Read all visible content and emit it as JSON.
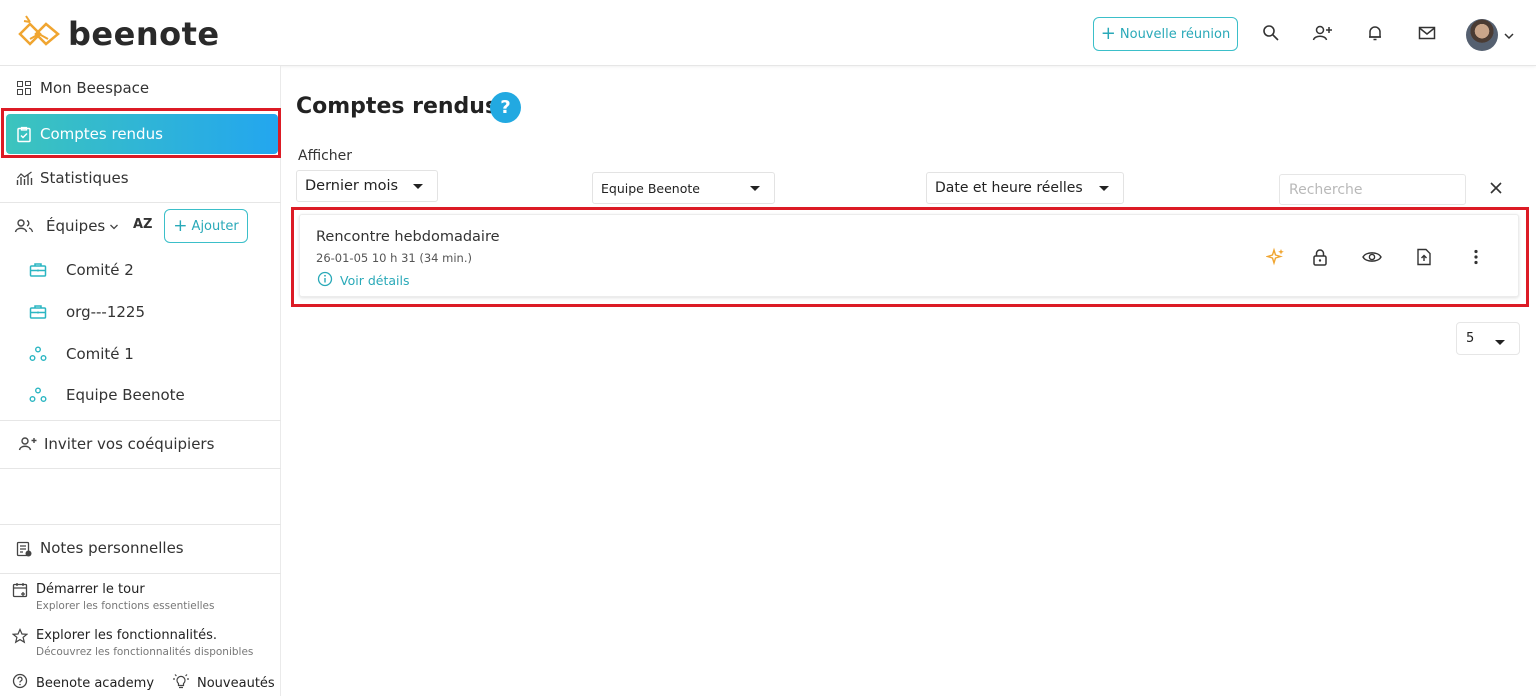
{
  "app": {
    "logo_text": "beenote",
    "accent": "#29a9b8",
    "highlight_color": "#dc1b25"
  },
  "topbar": {
    "new_meeting_label": "Nouvelle réunion",
    "icons": [
      "search-icon",
      "add-user-icon",
      "bell-icon",
      "mail-icon",
      "avatar",
      "chevron-down-icon"
    ]
  },
  "sidebar": {
    "items": [
      {
        "label": "Mon Beespace",
        "icon": "grid-icon"
      },
      {
        "label": "Comptes rendus",
        "icon": "clipboard-check-icon",
        "active": true
      },
      {
        "label": "Statistiques",
        "icon": "chart-icon"
      }
    ],
    "teams_label": "Équipes",
    "sort_label": "AZ",
    "add_label": "Ajouter",
    "teams": [
      {
        "label": "Comité 2",
        "icon": "briefcase-icon"
      },
      {
        "label": "org---1225",
        "icon": "briefcase-icon"
      },
      {
        "label": "Comité 1",
        "icon": "team-nodes-icon"
      },
      {
        "label": "Equipe Beenote",
        "icon": "team-nodes-icon"
      }
    ],
    "invite_label": "Inviter vos coéquipiers",
    "notes_label": "Notes personnelles",
    "tour": {
      "title": "Démarrer le tour",
      "subtitle": "Explorer les fonctions essentielles"
    },
    "explore": {
      "title": "Explorer les fonctionnalités.",
      "subtitle": "Découvrez les fonctionnalités disponibles"
    },
    "academy_label": "Beenote academy",
    "news_label": "Nouveautés"
  },
  "main": {
    "title": "Comptes rendus",
    "help_glyph": "?",
    "filter_label": "Afficher",
    "filters": {
      "period": "Dernier mois",
      "team": "Equipe Beenote",
      "date_mode": "Date et heure réelles"
    },
    "search_placeholder": "Recherche",
    "meetings": [
      {
        "title": "Rencontre hebdomadaire",
        "datetime": "26-01-05 10 h 31 (34 min.)",
        "details_link": "Voir détails"
      }
    ],
    "page_size": "5"
  }
}
